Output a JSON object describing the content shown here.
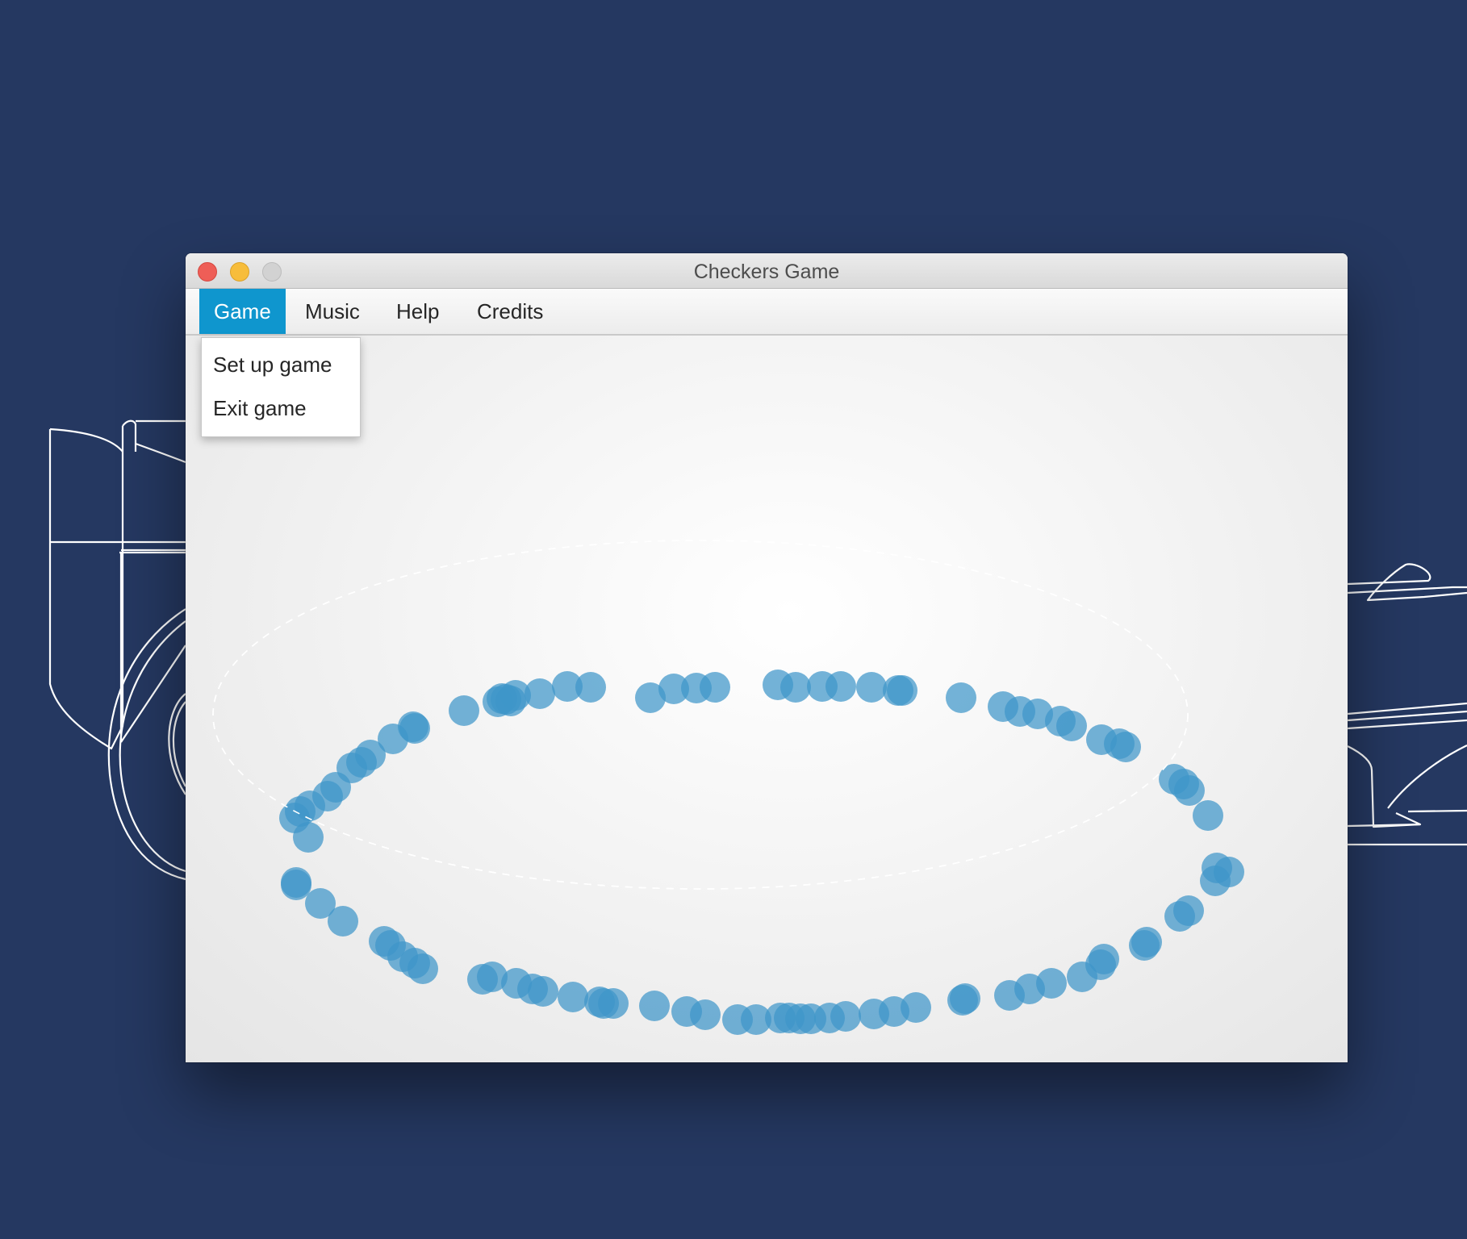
{
  "window": {
    "title": "Checkers Game"
  },
  "menubar": {
    "items": [
      {
        "label": "Game",
        "active": true
      },
      {
        "label": "Music",
        "active": false
      },
      {
        "label": "Help",
        "active": false
      },
      {
        "label": "Credits",
        "active": false
      }
    ]
  },
  "game_menu": {
    "items": [
      {
        "label": "Set up game"
      },
      {
        "label": "Exit game"
      }
    ]
  },
  "colors": {
    "background": "#253861",
    "menu_highlight": "#0f96ce",
    "piece": "#3f95c9",
    "piece_dark": "#0a70b6",
    "path": "#ffffff"
  },
  "icons": [
    "close-icon",
    "minimize-icon",
    "zoom-icon"
  ]
}
